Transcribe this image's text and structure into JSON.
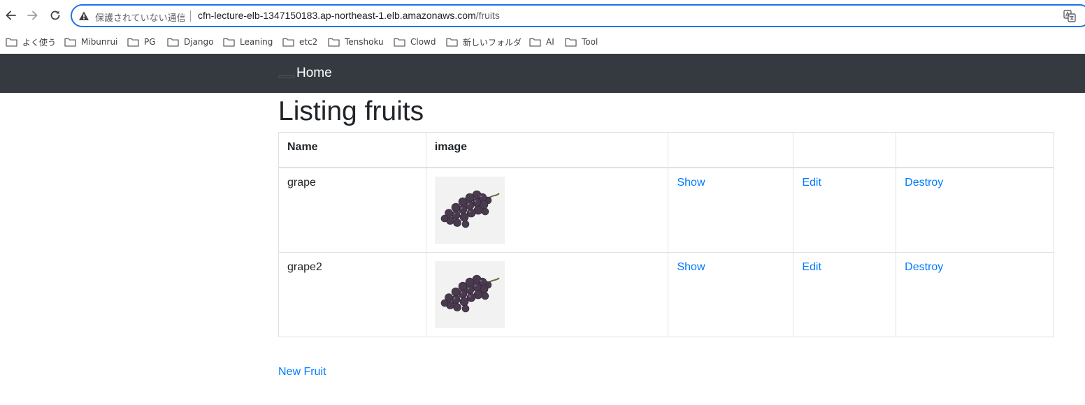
{
  "browser": {
    "security_label": "保護されていない通信",
    "url_host": "cfn-lecture-elb-1347150183.ap-northeast-1.elb.amazonaws.com",
    "url_path": "/fruits",
    "bookmarks": [
      "よく使う",
      "Mibunrui",
      "PG",
      "Django",
      "Leaning",
      "etc2",
      "Tenshoku",
      "Clowd",
      "新しいフォルダ",
      "AI",
      "Tool"
    ]
  },
  "navbar": {
    "brand": "Home",
    "background": "#343a40"
  },
  "page": {
    "title": "Listing fruits",
    "new_link": "New Fruit"
  },
  "table": {
    "headers": [
      "Name",
      "image",
      "",
      "",
      ""
    ],
    "rows": [
      {
        "name": "grape",
        "image_icon": "grape-photo",
        "show": "Show",
        "edit": "Edit",
        "destroy": "Destroy"
      },
      {
        "name": "grape2",
        "image_icon": "grape-photo",
        "show": "Show",
        "edit": "Edit",
        "destroy": "Destroy"
      }
    ]
  },
  "colors": {
    "link": "#007bff",
    "text": "#212529",
    "omnibox_border": "#1a73e8"
  }
}
